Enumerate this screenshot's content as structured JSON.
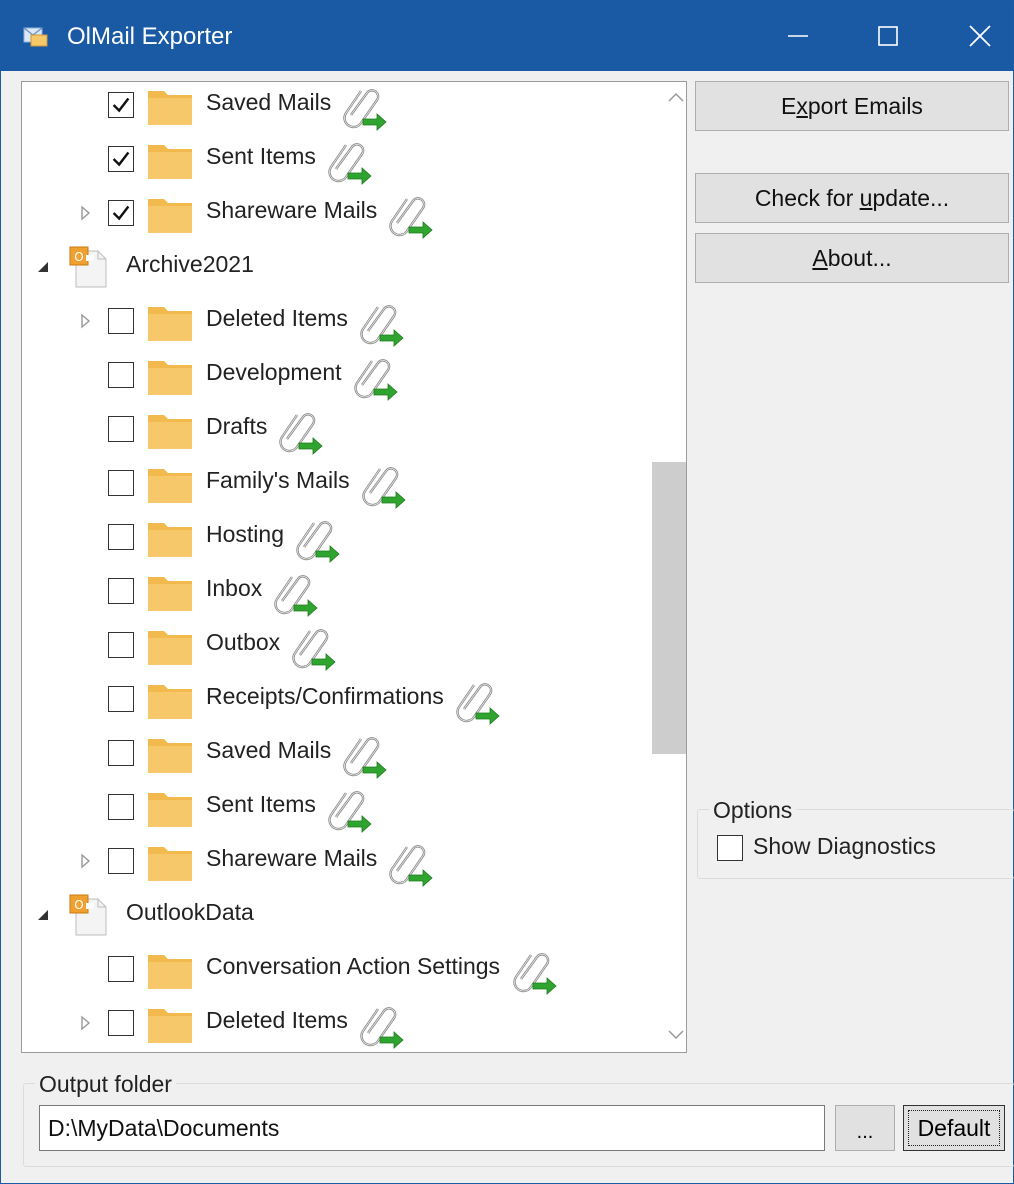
{
  "window": {
    "title": "OlMail Exporter"
  },
  "tree": {
    "rows": [
      {
        "type": "folder",
        "label": "Saved Mails",
        "checked": true,
        "expander": false
      },
      {
        "type": "folder",
        "label": "Sent Items",
        "checked": true,
        "expander": false
      },
      {
        "type": "folder",
        "label": "Shareware Mails",
        "checked": true,
        "expander": true
      },
      {
        "type": "store",
        "label": "Archive2021"
      },
      {
        "type": "folder",
        "label": "Deleted Items",
        "checked": false,
        "expander": true
      },
      {
        "type": "folder",
        "label": "Development",
        "checked": false,
        "expander": false
      },
      {
        "type": "folder",
        "label": "Drafts",
        "checked": false,
        "expander": false
      },
      {
        "type": "folder",
        "label": "Family's Mails",
        "checked": false,
        "expander": false
      },
      {
        "type": "folder",
        "label": "Hosting",
        "checked": false,
        "expander": false
      },
      {
        "type": "folder",
        "label": "Inbox",
        "checked": false,
        "expander": false
      },
      {
        "type": "folder",
        "label": "Outbox",
        "checked": false,
        "expander": false
      },
      {
        "type": "folder",
        "label": "Receipts/Confirmations",
        "checked": false,
        "expander": false
      },
      {
        "type": "folder",
        "label": "Saved Mails",
        "checked": false,
        "expander": false
      },
      {
        "type": "folder",
        "label": "Sent Items",
        "checked": false,
        "expander": false
      },
      {
        "type": "folder",
        "label": "Shareware Mails",
        "checked": false,
        "expander": true
      },
      {
        "type": "store",
        "label": "OutlookData"
      },
      {
        "type": "folder",
        "label": "Conversation Action Settings",
        "checked": false,
        "expander": false
      },
      {
        "type": "folder",
        "label": "Deleted Items",
        "checked": false,
        "expander": true
      }
    ]
  },
  "buttons": {
    "export_pre": "E",
    "export_key": "x",
    "export_post": "port Emails",
    "update_pre": "Check for ",
    "update_key": "u",
    "update_post": "pdate...",
    "about_key": "A",
    "about_post": "bout..."
  },
  "options": {
    "legend": "Options",
    "show_diag_pre": "Show Dia",
    "show_diag_key": "g",
    "show_diag_post": "nostics",
    "show_diagnostics_checked": false
  },
  "output": {
    "legend": "Output folder",
    "path": "D:\\MyData\\Documents",
    "browse_label": "...",
    "default_label": "Default"
  },
  "icons": {
    "app": "mail-folder-icon",
    "folder": "folder-icon",
    "store": "outlook-pst-icon",
    "attachment": "attachment-export-icon"
  },
  "colors": {
    "titlebar": "#1a5aa4",
    "folder": "#f7c86a",
    "arrow": "#2fa52f"
  }
}
